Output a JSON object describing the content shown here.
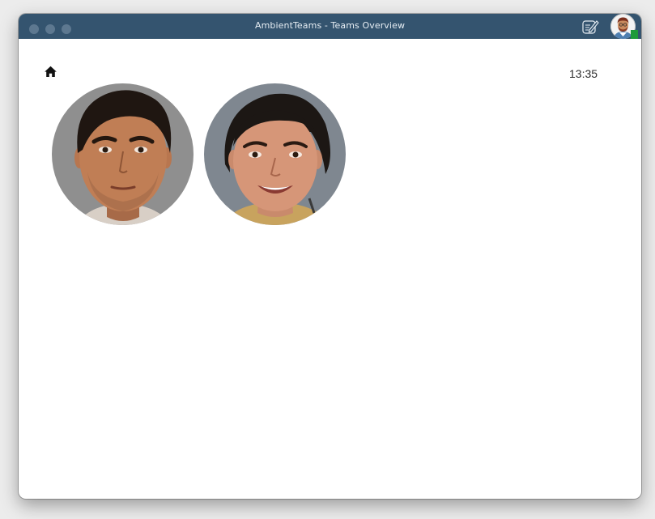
{
  "window": {
    "title": "AmbientTeams - Teams Overview"
  },
  "toolbar": {
    "edit_icon": "edit-icon",
    "user_avatar": "user-avatar",
    "presence_status": "online",
    "presence_color": "#1e9a3a"
  },
  "header": {
    "home_icon": "home-icon",
    "clock": "13:35"
  },
  "members": [
    {
      "avatar": "team-member-photo-man"
    },
    {
      "avatar": "team-member-photo-woman"
    }
  ],
  "colors": {
    "titlebar": "#34546f",
    "content_background": "#ffffff"
  }
}
